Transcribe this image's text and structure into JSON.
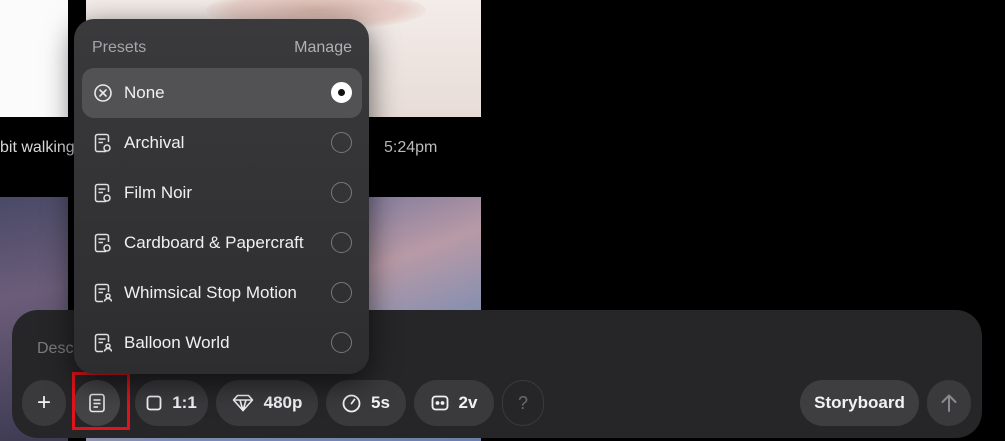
{
  "gallery": {
    "caption_left": "bit walking",
    "caption_time": "5:24pm"
  },
  "composer": {
    "placeholder": "Desc",
    "add_label": "+",
    "ratio_label": "1:1",
    "resolution_label": "480p",
    "duration_label": "5s",
    "variations_label": "2v",
    "help_label": "?",
    "storyboard_label": "Storyboard"
  },
  "presets_menu": {
    "title": "Presets",
    "manage_label": "Manage",
    "items": [
      {
        "label": "None",
        "icon": "circle-x-icon",
        "selected": true
      },
      {
        "label": "Archival",
        "icon": "preset-doc-icon",
        "selected": false
      },
      {
        "label": "Film Noir",
        "icon": "preset-doc-icon",
        "selected": false
      },
      {
        "label": "Cardboard & Papercraft",
        "icon": "preset-doc-icon",
        "selected": false
      },
      {
        "label": "Whimsical Stop Motion",
        "icon": "preset-doc-user-icon",
        "selected": false
      },
      {
        "label": "Balloon World",
        "icon": "preset-doc-user-icon",
        "selected": false
      }
    ]
  },
  "colors": {
    "highlight": "#e0141c",
    "composer_bg": "#262628",
    "menu_bg": "#333335"
  }
}
